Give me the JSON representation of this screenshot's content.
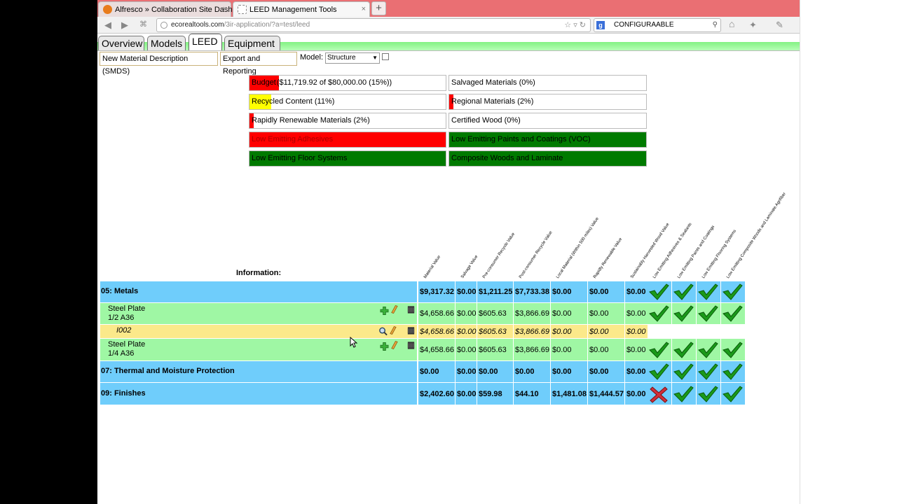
{
  "browser": {
    "tabs": [
      {
        "title": "Alfresco » Collaboration Site Dashboa...",
        "close": "×"
      },
      {
        "title": "LEED Management Tools",
        "close": "×"
      }
    ],
    "new_tab": "+",
    "url_host": "ecorealtools.com",
    "url_path": "/3ir-application/?a=test/leed",
    "search_value": "CONFIGURAABLE",
    "search_engine": "g"
  },
  "app": {
    "tabs": [
      "Overview",
      "Models",
      "LEED",
      "Equipment"
    ],
    "active_tab": "LEED",
    "toolbar": {
      "smds_button": "New Material Description (SMDS)",
      "export_button": "Export and Reporting",
      "model_label": "Model:",
      "model_value": "Structure"
    }
  },
  "credits": [
    {
      "label": "Budget",
      "extra": "($11,719.92 of $80,000.00 (15%))",
      "bar_color": "#ff0000",
      "fill": 0.15
    },
    {
      "label": "Salvaged Materials (0%)",
      "bar_color": "#ff0000",
      "fill": 0
    },
    {
      "label": "Recycled Content (11%)",
      "bar_color": "#ffff00",
      "fill": 0.11
    },
    {
      "label": "Regional Materials (2%)",
      "bar_color": "#ff0000",
      "fill": 0.02
    },
    {
      "label": "Rapidly Renewable Materials (2%)",
      "bar_color": "#ff0000",
      "fill": 0.02
    },
    {
      "label": "Certified Wood (0%)",
      "bar_color": "#ff0000",
      "fill": 0
    },
    {
      "label": "Low Emitting Adhesives",
      "bar_color": "#ff0000",
      "fill": 1
    },
    {
      "label": "Low Emitting Paints and Coatings (VOC)",
      "bar_color": "#007a00",
      "fill": 1
    },
    {
      "label": "Low Emitting Floor Systems",
      "bar_color": "#007a00",
      "fill": 1
    },
    {
      "label": "Composite Woods and Laminate",
      "bar_color": "#007a00",
      "fill": 1
    }
  ],
  "table": {
    "info_label": "Information:",
    "headers": [
      "Material Value",
      "Salvage Value",
      "Pre-consumer Recycle Value",
      "Post-consumer Recycle Value",
      "Local Material (Within 500 miles) Value",
      "Rapidly Renewable Value",
      "Sustainably Harvested Wood Value",
      "Low Emitting Adhesives & Sealants",
      "Low Emitting Paints and Coatings",
      "Low Emitting Flooring Systems",
      "Low Emitting Composite Woods and Laminate Agrifiber"
    ],
    "rows": [
      {
        "kind": "group",
        "label": "05: Metals",
        "values": [
          "$9,317.32",
          "$0.00",
          "$1,211.25",
          "$7,733.38",
          "$0.00",
          "$0.00",
          "$0.00"
        ],
        "checks": [
          "check",
          "check",
          "check",
          "check"
        ]
      },
      {
        "kind": "item",
        "label": "Steel Plate",
        "sub": "1/2 A36",
        "values": [
          "$4,658.66",
          "$0.00",
          "$605.63",
          "$3,866.69",
          "$0.00",
          "$0.00",
          "$0.00"
        ],
        "checks": [
          "check",
          "check",
          "check",
          "check"
        ]
      },
      {
        "kind": "instance",
        "label": "I002",
        "values": [
          "$4,658.66",
          "$0.00",
          "$605.63",
          "$3,866.69",
          "$0.00",
          "$0.00",
          "$0.00"
        ],
        "checks": []
      },
      {
        "kind": "item",
        "label": "Steel Plate",
        "sub": "1/4 A36",
        "values": [
          "$4,658.66",
          "$0.00",
          "$605.63",
          "$3,866.69",
          "$0.00",
          "$0.00",
          "$0.00"
        ],
        "checks": [
          "check",
          "check",
          "check",
          "check"
        ]
      },
      {
        "kind": "group",
        "label": "07: Thermal and Moisture Protection",
        "values": [
          "$0.00",
          "$0.00",
          "$0.00",
          "$0.00",
          "$0.00",
          "$0.00",
          "$0.00"
        ],
        "checks": [
          "check",
          "check",
          "check",
          "check"
        ]
      },
      {
        "kind": "group",
        "label": "09: Finishes",
        "values": [
          "$2,402.60",
          "$0.00",
          "$59.98",
          "$44.10",
          "$1,481.08",
          "$1,444.57",
          "$0.00"
        ],
        "checks": [
          "cross",
          "check",
          "check",
          "check"
        ]
      }
    ]
  },
  "colors": {
    "group": "#6fcdfb",
    "item": "#9ff7a4",
    "instance": "#fbe98a",
    "check": "#1a9a1a",
    "cross": "#d0303a"
  },
  "icons": {
    "row_actions": [
      "add-icon",
      "edit-icon",
      "delete-icon"
    ],
    "instance_actions": [
      "view-icon",
      "edit-icon",
      "delete-icon"
    ]
  }
}
